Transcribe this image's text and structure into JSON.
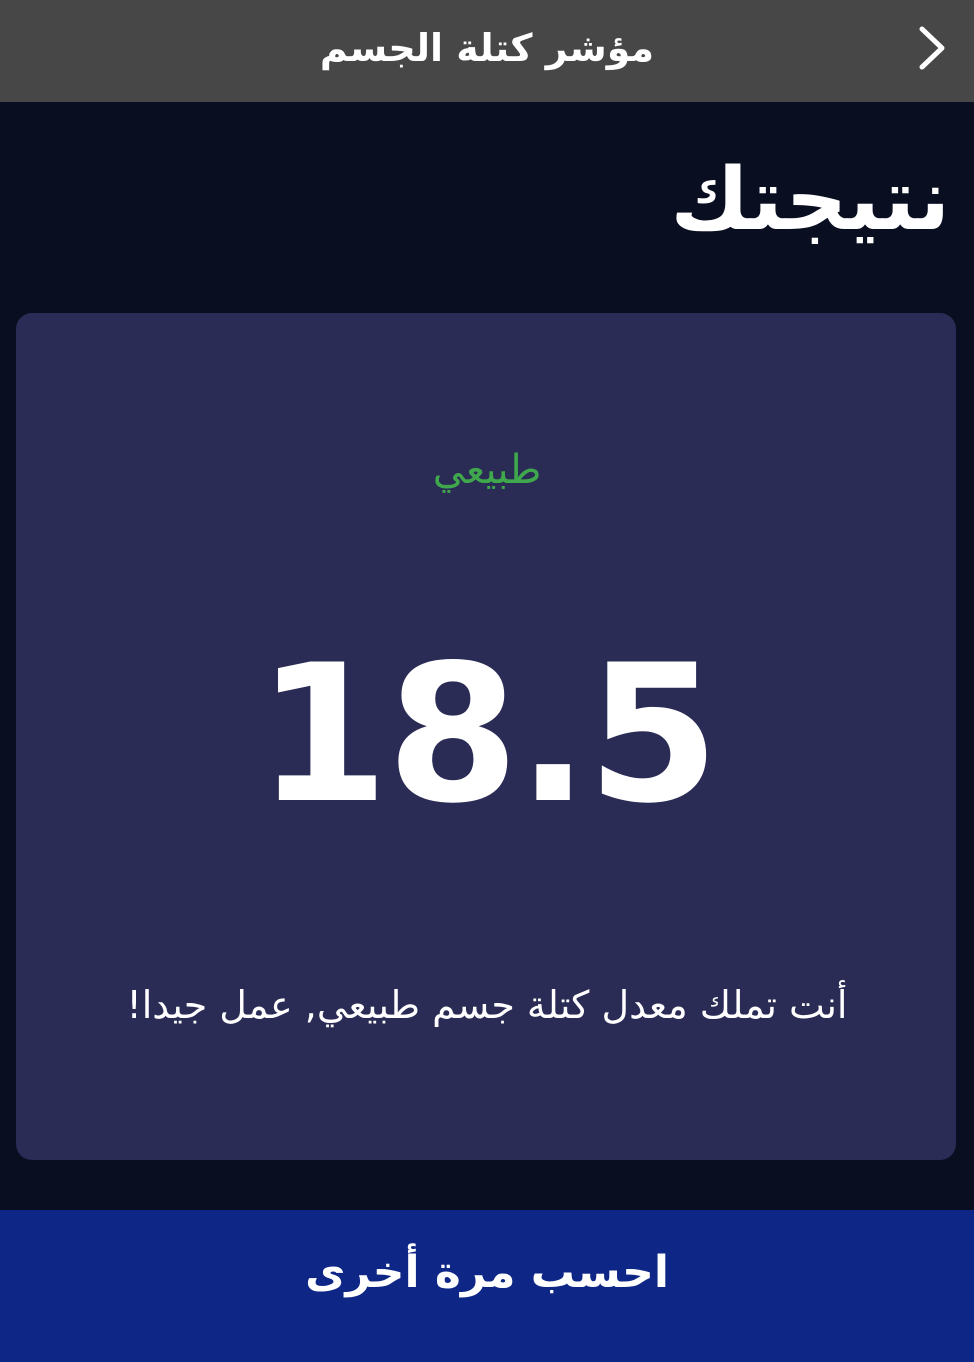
{
  "appbar": {
    "title": "مؤشر كتلة الجسم",
    "back_icon": "chevron-right-icon"
  },
  "result": {
    "heading": "نتيجتك",
    "status": "طبيعي",
    "status_color": "#3fa84c",
    "bmi": "18.5",
    "message": "أنت تملك معدل كتلة جسم طبيعي, عمل جيدا!"
  },
  "actions": {
    "recalculate_label": "احسب مرة أخرى"
  },
  "colors": {
    "background": "#0a0e21",
    "appbar": "#474747",
    "card": "#2a2c55",
    "button": "#0e2786"
  }
}
